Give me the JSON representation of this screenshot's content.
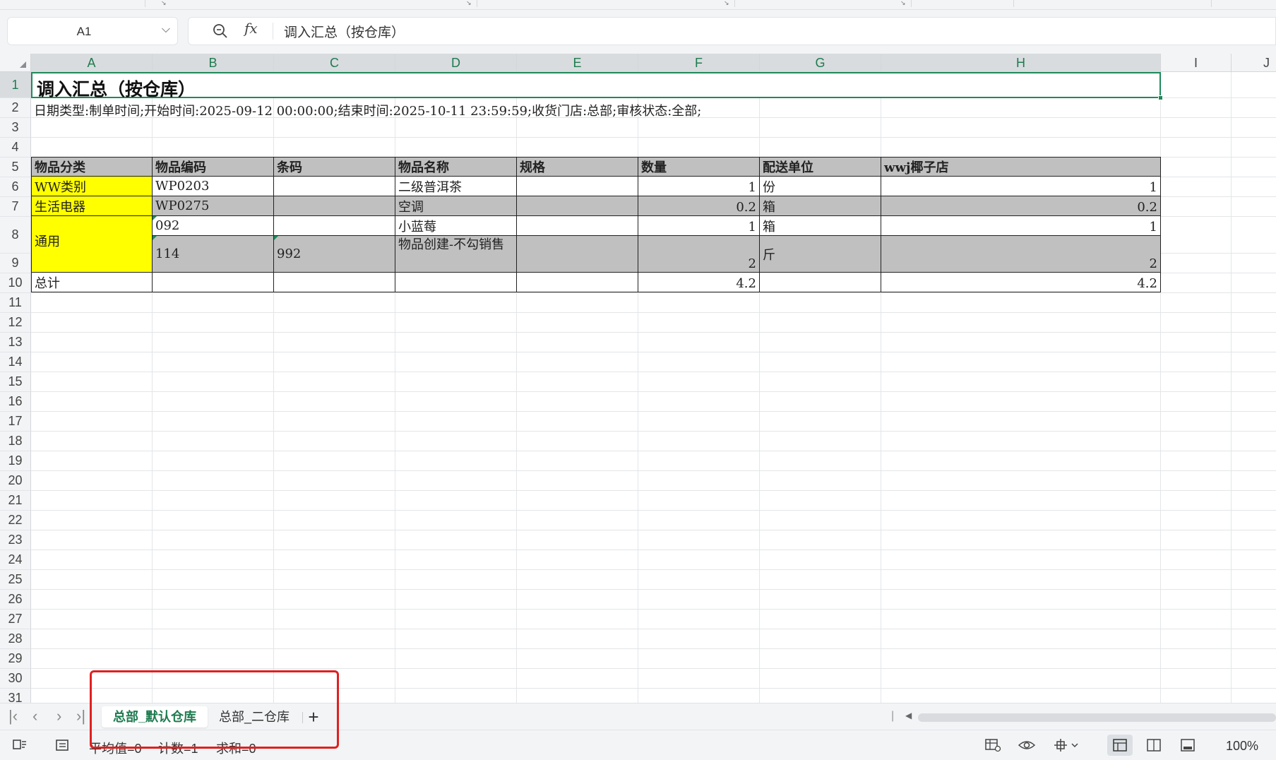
{
  "formula_bar": {
    "name_box": "A1",
    "formula": "调入汇总（按仓库）"
  },
  "columns": [
    "A",
    "B",
    "C",
    "D",
    "E",
    "F",
    "G",
    "H",
    "I",
    "J"
  ],
  "rows": [
    "1",
    "2",
    "3",
    "4",
    "5",
    "6",
    "7",
    "8",
    "9",
    "10",
    "11",
    "12",
    "13",
    "14",
    "15",
    "16",
    "17",
    "18",
    "19",
    "20",
    "21",
    "22",
    "23",
    "24",
    "25",
    "26",
    "27",
    "28",
    "29",
    "30",
    "31"
  ],
  "sheet": {
    "title": "调入汇总（按仓库）",
    "subtitle": "日期类型:制单时间;开始时间:2025-09-12 00:00:00;结束时间:2025-10-11 23:59:59;收货门店:总部;审核状态:全部;",
    "headers": [
      "物品分类",
      "物品编码",
      "条码",
      "物品名称",
      "规格",
      "数量",
      "配送单位",
      "wwj椰子店"
    ],
    "rows": [
      {
        "category": "WW类别",
        "code": "WP0203",
        "barcode": "",
        "name": "二级普洱茶",
        "spec": "",
        "qty": "1",
        "unit": "份",
        "store": "1"
      },
      {
        "category": "生活电器",
        "code": "WP0275",
        "barcode": "",
        "name": "空调",
        "spec": "",
        "qty": "0.2",
        "unit": "箱",
        "store": "0.2"
      },
      {
        "category": "通用",
        "code": "092",
        "barcode": "",
        "name": "小蓝莓",
        "spec": "",
        "qty": "1",
        "unit": "箱",
        "store": "1"
      },
      {
        "category": "",
        "code": "114",
        "barcode": "992",
        "name": "物品创建-不勾销售",
        "spec": "",
        "qty": "2",
        "unit": "斤",
        "store": "2"
      }
    ],
    "total": {
      "label": "总计",
      "qty": "4.2",
      "store": "4.2"
    }
  },
  "tabs": {
    "active": "总部_默认仓库",
    "inactive": "总部_二仓库",
    "add": "+"
  },
  "status": {
    "average": "平均值=0",
    "count": "计数=1",
    "sum": "求和=0",
    "zoom": "100%"
  },
  "colors": {
    "accent": "#1e7b4f",
    "header_fill": "#c0c0c0",
    "highlight_fill": "#ffff00",
    "annotation": "#e02020"
  },
  "icons": {
    "zoom_formula": "magnifier-icon",
    "fx": "function-icon",
    "first_sheet": "first-sheet-icon",
    "prev_sheet": "prev-sheet-icon",
    "next_sheet": "next-sheet-icon",
    "last_sheet": "last-sheet-icon"
  }
}
